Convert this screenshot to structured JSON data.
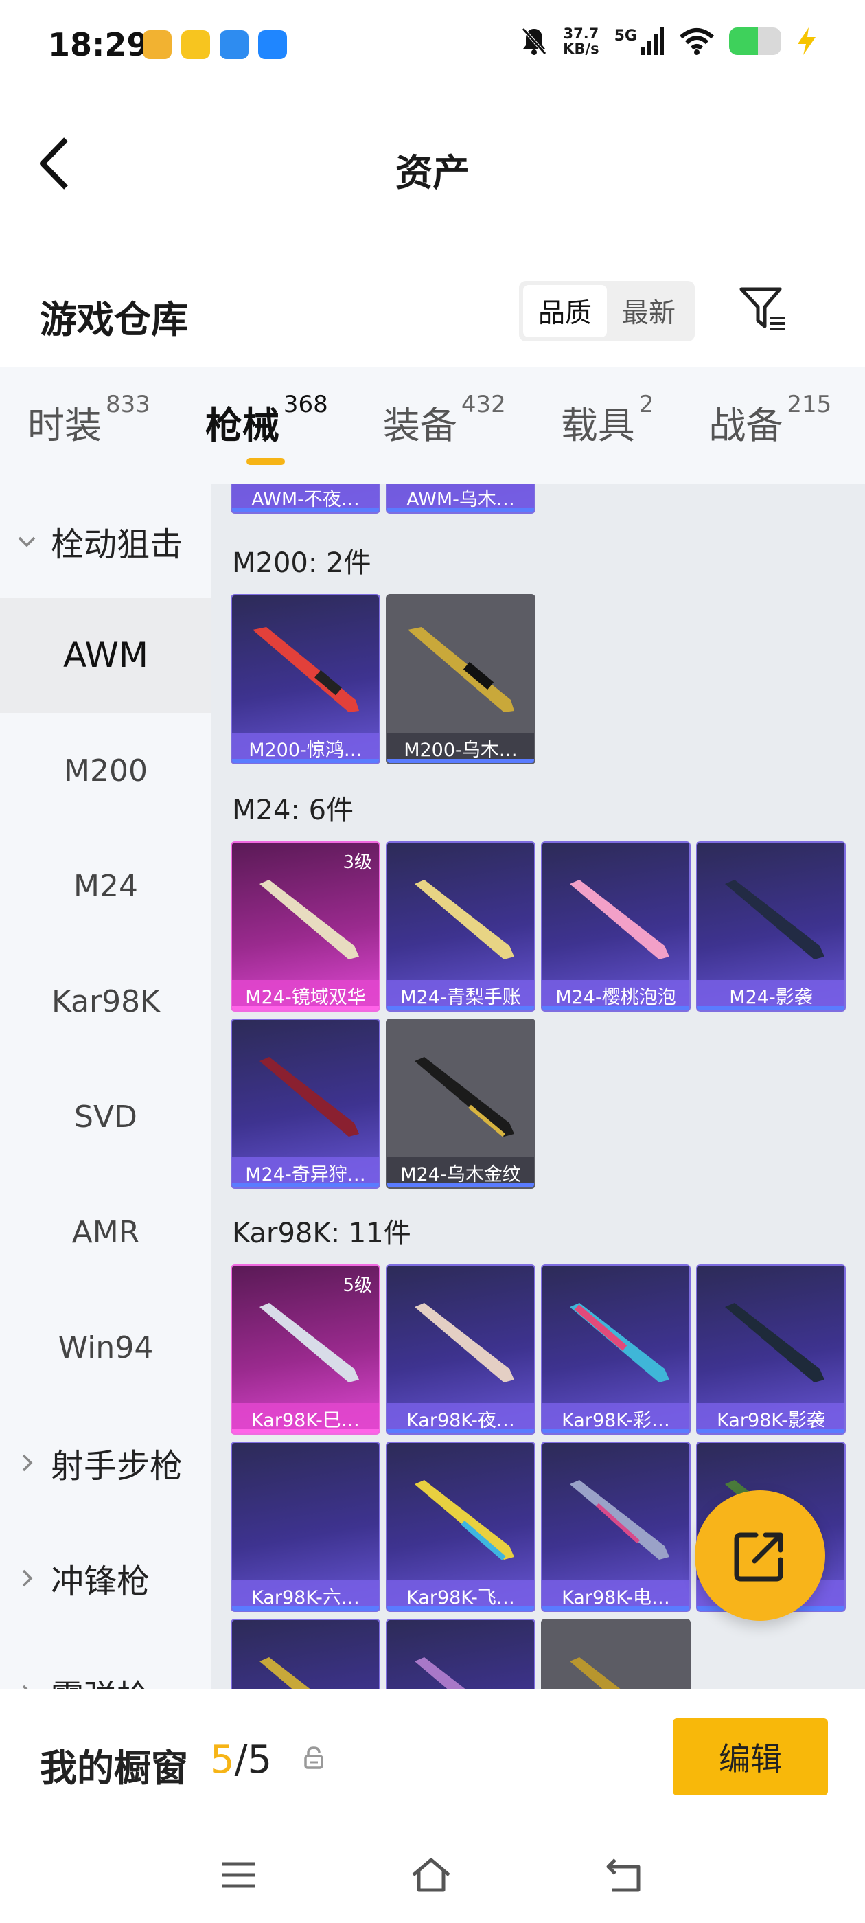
{
  "status_bar": {
    "time": "18:29",
    "net_speed_value": "37.7",
    "net_speed_unit": "KB/s",
    "signal_label": "5G",
    "app_icon_colors": [
      "#f2b231",
      "#f7c51f",
      "#2e8cf0",
      "#1f86ff"
    ]
  },
  "header": {
    "title": "资产",
    "back_icon": "chevron-left-icon"
  },
  "warehouse": {
    "title": "游戏仓库",
    "sort_options": [
      "品质",
      "最新"
    ],
    "sort_selected": "品质",
    "filter_icon": "filter-icon"
  },
  "tabs": [
    {
      "label": "时装",
      "count": "833"
    },
    {
      "label": "枪械",
      "count": "368"
    },
    {
      "label": "装备",
      "count": "432"
    },
    {
      "label": "载具",
      "count": "2"
    },
    {
      "label": "战备",
      "count": "215"
    }
  ],
  "active_tab": "枪械",
  "sidenav": {
    "group_open": "栓动狙击",
    "items": [
      "AWM",
      "M200",
      "M24",
      "Kar98K",
      "SVD",
      "AMR",
      "Win94"
    ],
    "active_item": "AWM",
    "groups_closed": [
      "射手步枪",
      "冲锋枪",
      "霰弹枪"
    ]
  },
  "content": {
    "top_cards": [
      "AWM-不夜…",
      "AWM-乌木…"
    ],
    "sections": [
      {
        "title": "M200: 2件",
        "cards": [
          {
            "label": "M200-惊鸿…",
            "style": "purple",
            "level": ""
          },
          {
            "label": "M200-乌木…",
            "style": "gray",
            "level": ""
          }
        ]
      },
      {
        "title": "M24: 6件",
        "cards": [
          {
            "label": "M24-镜域双华",
            "style": "pink",
            "level": "3级"
          },
          {
            "label": "M24-青梨手账",
            "style": "purple",
            "level": ""
          },
          {
            "label": "M24-樱桃泡泡",
            "style": "purple",
            "level": ""
          },
          {
            "label": "M24-影袭",
            "style": "purple",
            "level": ""
          },
          {
            "label": "M24-奇异狩…",
            "style": "purple",
            "level": ""
          },
          {
            "label": "M24-乌木金纹",
            "style": "gray",
            "level": ""
          }
        ]
      },
      {
        "title": "Kar98K: 11件",
        "cards": [
          {
            "label": "Kar98K-巳…",
            "style": "pink",
            "level": "5级"
          },
          {
            "label": "Kar98K-夜…",
            "style": "purple",
            "level": ""
          },
          {
            "label": "Kar98K-彩…",
            "style": "purple",
            "level": ""
          },
          {
            "label": "Kar98K-影袭",
            "style": "purple",
            "level": ""
          },
          {
            "label": "Kar98K-六…",
            "style": "purple",
            "level": ""
          },
          {
            "label": "Kar98K-飞…",
            "style": "purple",
            "level": ""
          },
          {
            "label": "Kar98K-电…",
            "style": "purple",
            "level": ""
          },
          {
            "label": "…",
            "style": "purple",
            "level": ""
          }
        ]
      }
    ]
  },
  "showcase": {
    "label": "我的橱窗",
    "current": "5",
    "separator": "/",
    "total": "5",
    "edit_label": "编辑"
  },
  "colors": {
    "accent": "#f8b80a",
    "card_purple": "#3e3390",
    "card_pink": "#9a2a8e",
    "card_gray": "#5c5c64"
  }
}
